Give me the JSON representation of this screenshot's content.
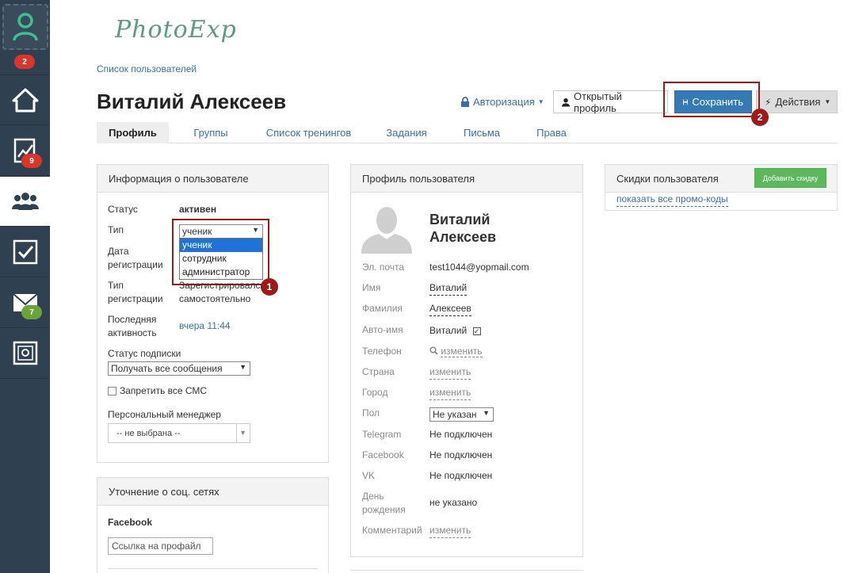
{
  "sidebar": {
    "badges": {
      "avatar": "2",
      "stats": "9",
      "mail": "7"
    },
    "icons": [
      "user-icon",
      "home-icon",
      "chart-icon",
      "users-icon",
      "checkbox-icon",
      "mail-icon",
      "safe-icon"
    ]
  },
  "logo": "PhotoExp",
  "breadcrumb": "Список пользователей",
  "page_title": "Виталий Алексеев",
  "header": {
    "auth": "Авторизация",
    "open_profile": "Открытый профиль",
    "save": "Сохранить",
    "actions": "Действия"
  },
  "markers": {
    "one": "1",
    "two": "2"
  },
  "tabs": [
    "Профиль",
    "Группы",
    "Список тренингов",
    "Задания",
    "Письма",
    "Права"
  ],
  "user_info": {
    "title": "Информация о пользователе",
    "status_label": "Статус",
    "status_value": "активен",
    "type_label": "Тип",
    "type_selected": "ученик",
    "type_options": [
      "ученик",
      "сотрудник",
      "администратор"
    ],
    "reg_date_label_1": "Дата",
    "reg_date_label_2": "регистрации",
    "reg_type_label_1": "Тип",
    "reg_type_label_2": "регистрации",
    "reg_type_value_1": "Зарегистрировался",
    "reg_type_value_2": "самостоятельно",
    "last_activity_label_1": "Последняя",
    "last_activity_label_2": "активность",
    "last_activity_value": "вчера 11:44",
    "subscription_label": "Статус подписки",
    "subscription_value": "Получать все сообщения",
    "sms_label": "Запретить все СМС",
    "manager_label": "Персональный менеджер",
    "manager_value": "-- не выбрана --"
  },
  "social": {
    "title": "Уточнение о соц. сетях",
    "facebook_label": "Facebook",
    "facebook_placeholder": "Ссылка на профайл"
  },
  "profile": {
    "title": "Профиль пользователя",
    "name_line_1": "Виталий",
    "name_line_2": "Алексеев",
    "email_label": "Эл. почта",
    "email_value": "test1044@yopmail.com",
    "first_name_label": "Имя",
    "first_name_value": "Виталий",
    "last_name_label": "Фамилия",
    "last_name_value": "Алексеев",
    "autoname_label": "Авто-имя",
    "autoname_value": "Виталий",
    "phone_label": "Телефон",
    "phone_value": "изменить",
    "country_label": "Страна",
    "country_value": "изменить",
    "city_label": "Город",
    "city_value": "изменить",
    "gender_label": "Пол",
    "gender_value": "Не указан",
    "telegram_label": "Telegram",
    "telegram_value": "Не подключен",
    "facebook_label": "Facebook",
    "facebook_value": "Не подключен",
    "vk_label": "VK",
    "vk_value": "Не подключен",
    "birthday_label_1": "День",
    "birthday_label_2": "рождения",
    "birthday_value": "не указано",
    "comment_label": "Комментарий",
    "comment_value": "изменить"
  },
  "discounts": {
    "title": "Скидки пользователя",
    "add_button": "Добавить скидку",
    "show_promo": "показать все промо-коды"
  }
}
